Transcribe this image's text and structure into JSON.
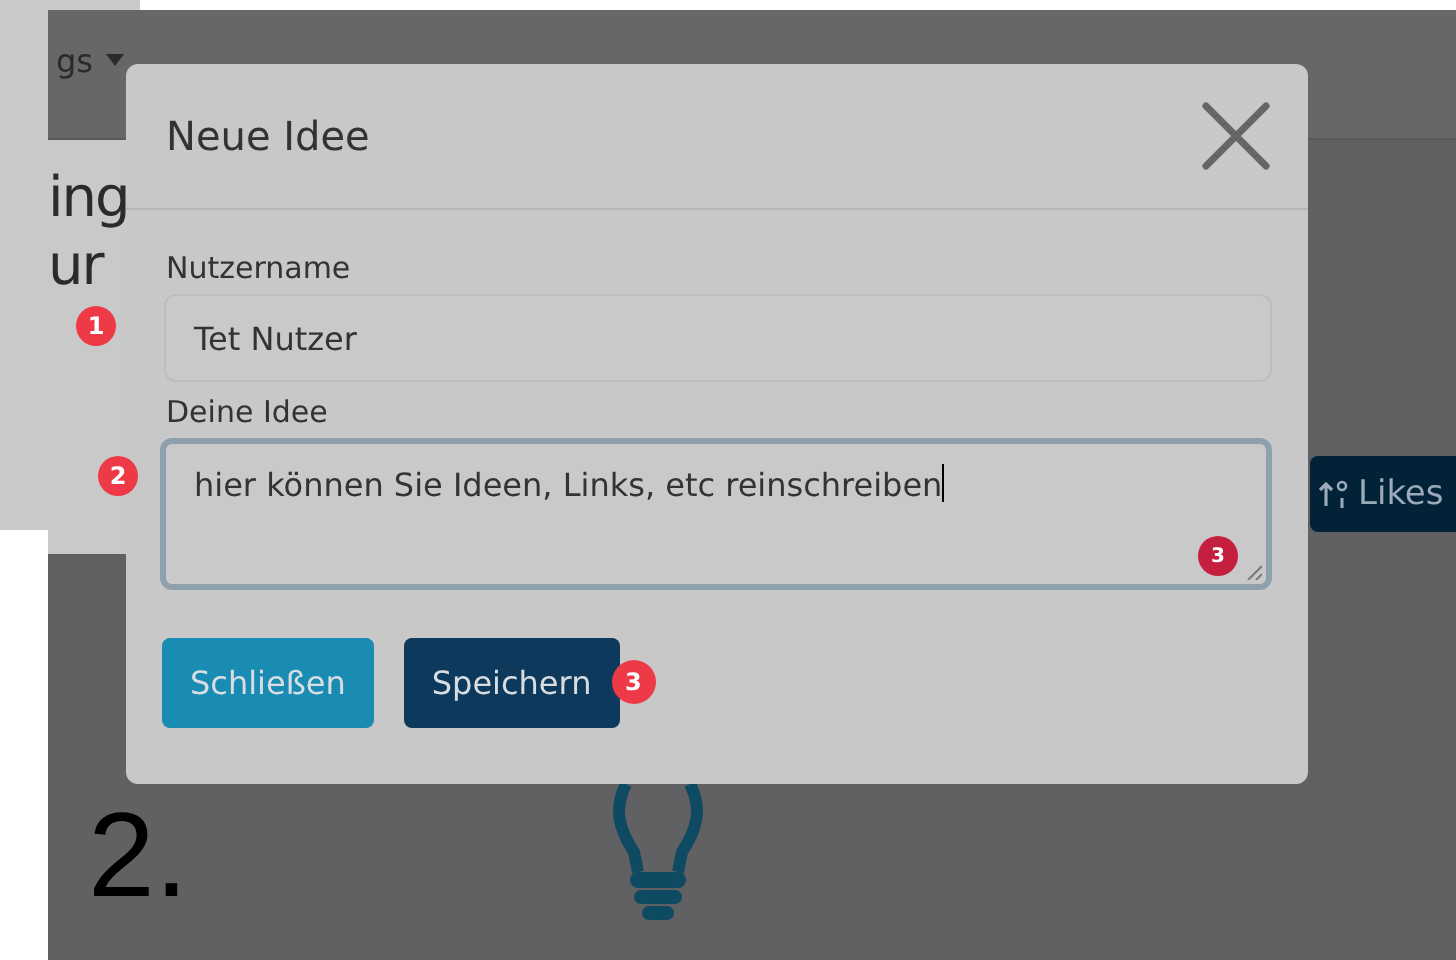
{
  "background_page": {
    "menu_label": "gs",
    "heading_lines": [
      "ing",
      "ur"
    ],
    "likes_button": "Likes"
  },
  "dialog": {
    "title": "Neue Idee",
    "fields": [
      {
        "kind": "input",
        "label": "Nutzername",
        "value": "Tet Nutzer",
        "focused": false,
        "marker": "1"
      },
      {
        "kind": "textarea",
        "label": "Deine Idee",
        "value": "hier können Sie Ideen, Links, etc reinschreiben",
        "focused": true,
        "marker": "2",
        "inner_marker": "3"
      }
    ],
    "buttons": [
      {
        "kind": "secondary",
        "label": "Schließen"
      },
      {
        "kind": "primary",
        "label": "Speichern",
        "marker": "3"
      }
    ]
  },
  "step_label": "2."
}
